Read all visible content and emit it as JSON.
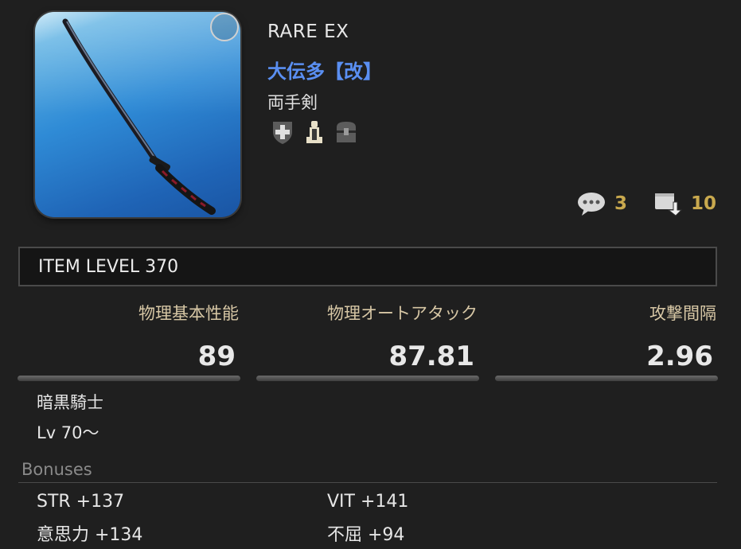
{
  "item": {
    "rarity": "RARE EX",
    "name": "大伝多【改】",
    "category": "両手剣",
    "flag_icons": [
      "shield-cross-icon",
      "dye-bottle-icon",
      "chest-icon"
    ]
  },
  "counts": {
    "comments": "3",
    "comments_icon": "speech-bubble-icon",
    "saves": "10",
    "saves_icon": "save-arrow-icon"
  },
  "item_level": "ITEM LEVEL 370",
  "stats": [
    {
      "label": "物理基本性能",
      "value": "89"
    },
    {
      "label": "物理オートアタック",
      "value": "87.81"
    },
    {
      "label": "攻撃間隔",
      "value": "2.96"
    }
  ],
  "requirements": {
    "job": "暗黒騎士",
    "level": "Lv 70～"
  },
  "bonuses": {
    "title": "Bonuses",
    "items": [
      "STR +137",
      "VIT +141",
      "意思力 +134",
      "不屈 +94"
    ]
  },
  "colors": {
    "name": "#5a8ff2",
    "count_text": "#c9a94e",
    "stat_label": "#d7c7a5"
  }
}
